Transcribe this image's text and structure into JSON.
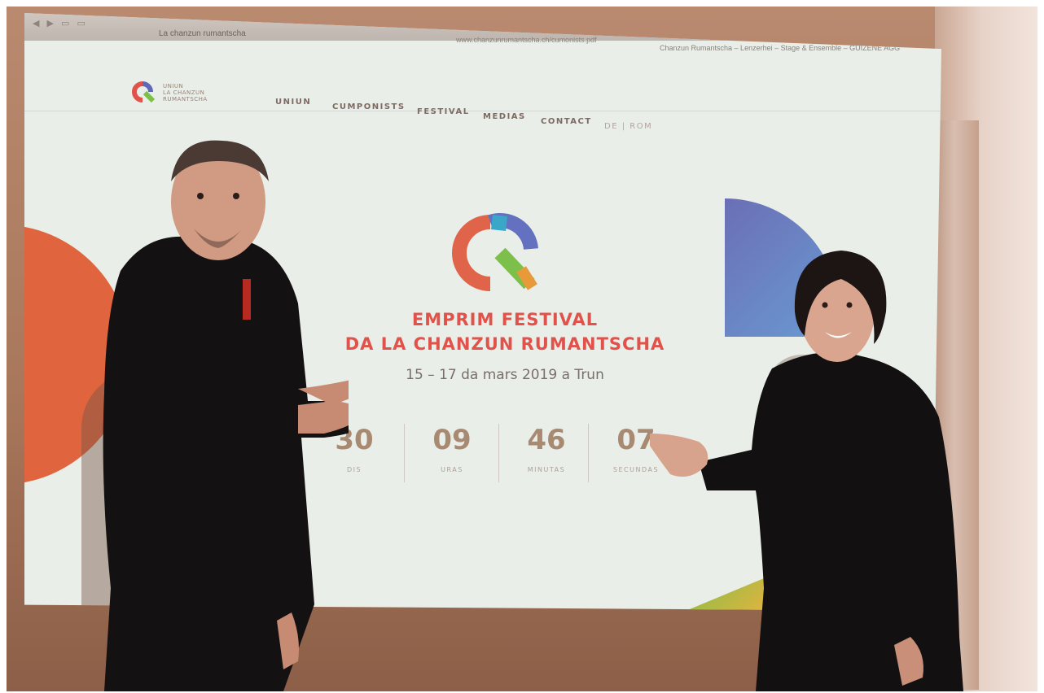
{
  "browser": {
    "tab_title": "La chanzun rumantscha",
    "url": "chanzunrumantscha.ch",
    "sub_url": "www.chanzunrumantscha.ch/cumonists.pdf",
    "right_tab": "Chanzun Rumantscha – Lenzerhei – Stage & Ensemble – GUIZENE AGG"
  },
  "site": {
    "logo_text": [
      "UNIUN",
      "LA CHANZUN",
      "RUMANTSCHA"
    ],
    "nav": [
      "UNIUN",
      "CUMPONISTS",
      "FESTIVAL",
      "MEDIAS",
      "CONTACT"
    ],
    "lang": "DE | ROM",
    "title_line1": "EMPRIM FESTIVAL",
    "title_line2": "DA LA CHANZUN RUMANTSCHA",
    "date": "15 – 17 da mars 2019 a Trun",
    "countdown": [
      {
        "value": "30",
        "label": "DIS"
      },
      {
        "value": "09",
        "label": "URAS"
      },
      {
        "value": "46",
        "label": "MINUTAS"
      },
      {
        "value": "07",
        "label": "SECUNDAS"
      }
    ]
  },
  "colors": {
    "title": "#e0524a",
    "countdown": "#a88a72",
    "accent_orange": "#e0643d",
    "accent_blue": "#6b6fb5"
  }
}
